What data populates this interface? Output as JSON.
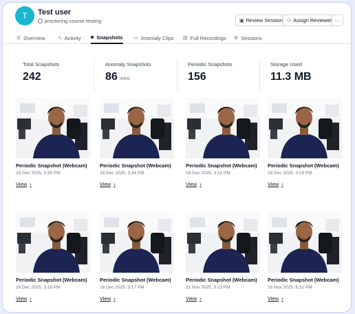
{
  "user": {
    "initial": "T",
    "name": "Test user",
    "course": "proctoring course testing",
    "course_icon": "link-icon",
    "avatar_color": "#19b6cf"
  },
  "header_buttons": [
    {
      "label": "Review Session",
      "icon": "review-icon"
    },
    {
      "label": "Assign Reviewer",
      "icon": "user-plus-icon"
    },
    {
      "label": "···",
      "icon": "more-icon"
    }
  ],
  "tabs": [
    {
      "label": "Overview",
      "icon": "list-icon",
      "active": false
    },
    {
      "label": "Activity",
      "icon": "activity-icon",
      "active": false
    },
    {
      "label": "Snapshots",
      "icon": "camera-icon",
      "active": true
    },
    {
      "label": "Anomaly Clips",
      "icon": "video-icon",
      "active": false
    },
    {
      "label": "Full Recordings",
      "icon": "film-icon",
      "active": false
    },
    {
      "label": "Sessions",
      "icon": "sessions-icon",
      "active": false
    }
  ],
  "stats": [
    {
      "label": "Total Snapshots",
      "value": "242",
      "unit": ""
    },
    {
      "label": "Anomaly Snapshots",
      "value": "86",
      "unit": "mins"
    },
    {
      "label": "Periodic Snapshots",
      "value": "156",
      "unit": ""
    },
    {
      "label": "Storage Used",
      "value": "11.3 MB",
      "unit": ""
    }
  ],
  "snapshots": [
    {
      "title": "Periodic Snapshot (Webcam)",
      "date": "18 Dec 2025, 3:35 PM",
      "action": "View"
    },
    {
      "title": "Periodic Snapshot (Webcam)",
      "date": "18 Dec 2025, 3:34 PM",
      "action": "View"
    },
    {
      "title": "Periodic Snapshot (Webcam)",
      "date": "18 Dec 2025, 3:32 PM",
      "action": "View"
    },
    {
      "title": "Periodic Snapshot (Webcam)",
      "date": "18 Dec 2025, 3:19 PM",
      "action": "View"
    },
    {
      "title": "Periodic Snapshot (Webcam)",
      "date": "18 Dec 2025, 3:18 PM",
      "action": "View"
    },
    {
      "title": "Periodic Snapshot (Webcam)",
      "date": "18 Dec 2025, 3:17 PM",
      "action": "View"
    },
    {
      "title": "Periodic Snapshot (Webcam)",
      "date": "21 Nov 2025, 5:23 PM",
      "action": "View"
    },
    {
      "title": "Periodic Snapshot (Webcam)",
      "date": "18 Nov 2025, 6:31 PM",
      "action": "View"
    }
  ],
  "colors": {
    "accent": "#19b6cf",
    "frame_border": "#c9cff3",
    "background": "#e9ecfb",
    "shirt": "#1b2452"
  }
}
